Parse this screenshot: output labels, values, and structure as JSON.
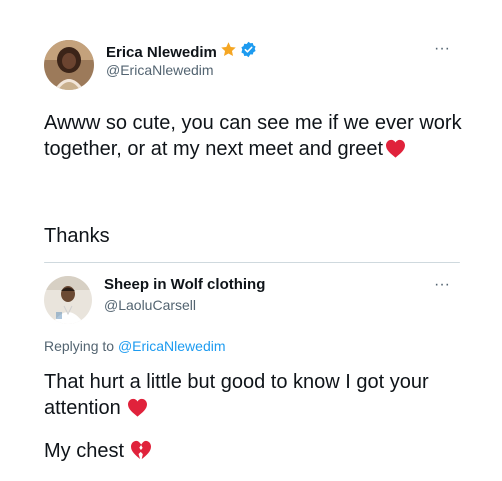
{
  "tweet": {
    "name": "Erica Nlewedim",
    "handle": "@EricaNlewedim",
    "body": "Awww so cute, you can see me if we ever work together, or at my next meet and greet",
    "thanks": "Thanks",
    "more": "···"
  },
  "reply": {
    "name": "Sheep in Wolf clothing",
    "handle": "@LaoluCarsell",
    "replying_prefix": "Replying to ",
    "replying_handle": "@EricaNlewedim",
    "body": "That hurt a little but good to know I got your attention",
    "chest": "My chest",
    "more": "···"
  },
  "colors": {
    "verified": "#1d9bf0",
    "star": "#f5a623",
    "heart": "#e0223b",
    "link": "#1d9bf0"
  }
}
